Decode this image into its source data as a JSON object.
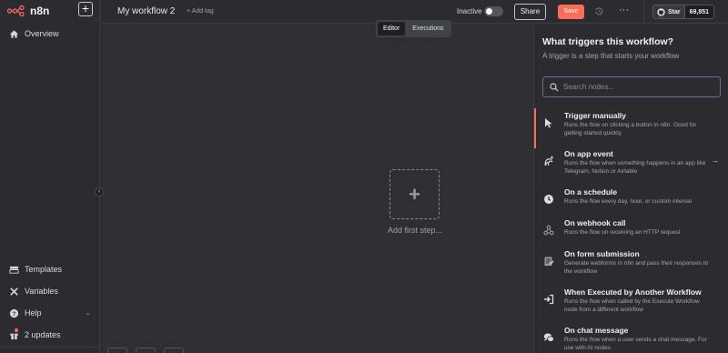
{
  "brand": {
    "name": "n8n"
  },
  "sidebar": {
    "items": [
      {
        "label": "Overview",
        "icon": "home-icon"
      },
      {
        "label": "Templates",
        "icon": "templates-icon"
      },
      {
        "label": "Variables",
        "icon": "variables-icon"
      },
      {
        "label": "Help",
        "icon": "help-icon"
      },
      {
        "label": "2 updates",
        "icon": "gift-icon"
      }
    ]
  },
  "header": {
    "workflow_name": "My workflow 2",
    "add_tag": "+ Add tag",
    "status_label": "Inactive",
    "share_label": "Share",
    "save_label": "Save",
    "github_star_label": "Star",
    "github_star_count": "69,851"
  },
  "canvas": {
    "tabs": [
      {
        "label": "Editor",
        "active": true
      },
      {
        "label": "Executions",
        "active": false
      }
    ],
    "add_first_step": "Add first step..."
  },
  "panel": {
    "title": "What triggers this workflow?",
    "subtitle": "A trigger is a step that starts your workflow",
    "search_placeholder": "Search nodes...",
    "items": [
      {
        "title": "Trigger manually",
        "description": "Runs the flow on clicking a button in n8n. Good for getting started quickly",
        "icon": "cursor-icon"
      },
      {
        "title": "On app event",
        "description": "Runs the flow when something happens in an app like Telegram, Notion or Airtable",
        "icon": "app-event-icon"
      },
      {
        "title": "On a schedule",
        "description": "Runs the flow every day, hour, or custom interval",
        "icon": "clock-icon"
      },
      {
        "title": "On webhook call",
        "description": "Runs the flow on receiving an HTTP request",
        "icon": "webhook-icon"
      },
      {
        "title": "On form submission",
        "description": "Generate webforms in n8n and pass their responses to the workflow",
        "icon": "form-icon"
      },
      {
        "title": "When Executed by Another Workflow",
        "description": "Runs the flow when called by the Execute Workflow node from a different workflow",
        "icon": "sign-in-icon"
      },
      {
        "title": "On chat message",
        "description": "Runs the flow when a user sends a chat message. For use with AI nodes",
        "icon": "chat-icon"
      }
    ]
  },
  "colors": {
    "accent": "#ff6d5a",
    "background": "#2e2e33",
    "panel": "#2b2b30"
  }
}
